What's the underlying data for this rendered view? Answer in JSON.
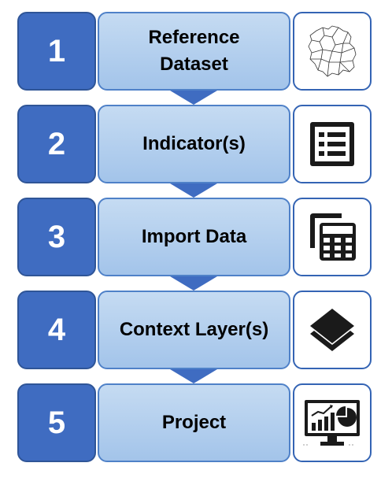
{
  "steps": [
    {
      "number": "1",
      "label": "Reference\nDataset",
      "icon": "map-outline-icon"
    },
    {
      "number": "2",
      "label": "Indicator(s)",
      "icon": "list-icon"
    },
    {
      "number": "3",
      "label": "Import Data",
      "icon": "calculator-icon"
    },
    {
      "number": "4",
      "label": "Context Layer(s)",
      "icon": "layers-icon"
    },
    {
      "number": "5",
      "label": "Project",
      "icon": "dashboard-monitor-icon"
    }
  ],
  "colors": {
    "number_fill": "#3f6cc1",
    "number_border": "#2f5597",
    "label_fill_top": "#c5dbf2",
    "label_fill_bottom": "#a3c4ea",
    "icon_border": "#3464b4",
    "arrow": "#3f6cc1"
  }
}
